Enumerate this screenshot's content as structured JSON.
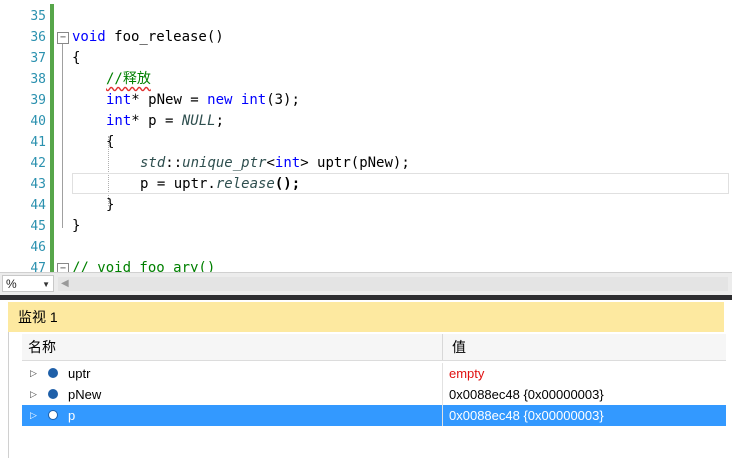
{
  "editor": {
    "line_numbers": [
      "35",
      "36",
      "37",
      "38",
      "39",
      "40",
      "41",
      "42",
      "43",
      "44",
      "45",
      "46",
      "47"
    ],
    "lines": {
      "l36": {
        "kw": "void",
        "rest": " foo_release()"
      },
      "l37": "{",
      "l38": "//释放",
      "l39": {
        "kw1": "int",
        "mid1": "* pNew = ",
        "kw2": "new",
        "mid2": " ",
        "kw3": "int",
        "rest": "(3);"
      },
      "l40": {
        "kw": "int",
        "mid": "* p = ",
        "it": "NULL",
        "rest": ";"
      },
      "l41": "{",
      "l42": {
        "it1": "std",
        "sep": "::",
        "it2": "unique_ptr",
        "lt": "<",
        "kw": "int",
        "rest": "> uptr(pNew);"
      },
      "l43": {
        "pre": "p = uptr.",
        "it": "release",
        "rest": "();"
      },
      "l44": "}",
      "l45": "}",
      "l47": {
        "cm": "// void foo_ary()"
      }
    }
  },
  "zoom": {
    "value": "%"
  },
  "watch": {
    "title": "监视 1",
    "col_name": "名称",
    "col_value": "值",
    "rows": [
      {
        "name": "uptr",
        "value": "empty",
        "value_color": "#e01010"
      },
      {
        "name": "pNew",
        "value": "0x0088ec48 {0x00000003}"
      },
      {
        "name": "p",
        "value": "0x0088ec48 {0x00000003}",
        "selected": true
      }
    ]
  },
  "colors": {
    "accent": "#3399ff",
    "watch_title_bg": "#fde9a0",
    "line_numbers": "#2b91af",
    "keyword": "#0000ff",
    "comment": "#008000"
  }
}
